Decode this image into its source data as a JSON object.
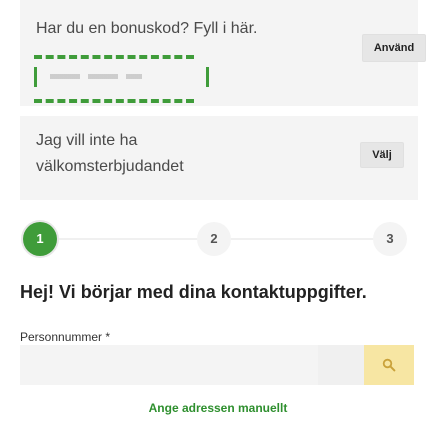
{
  "bonus": {
    "title": "Har du en bonuskod? Fyll i här.",
    "apply_label": "Använd"
  },
  "no_offer": {
    "text": "Jag vill inte ha välkomsterbjudandet",
    "choose_label": "Välj"
  },
  "steps": [
    {
      "label": "1",
      "active": true
    },
    {
      "label": "2",
      "active": false
    },
    {
      "label": "3",
      "active": false
    }
  ],
  "form": {
    "heading": "Hej! Vi börjar med dina kontaktuppgifter.",
    "personnummer_label": "Personnummer *",
    "personnummer_value": "",
    "search_icon": "search-icon",
    "manual_address_link": "Ange adressen manuellt"
  },
  "colors": {
    "accent_green": "#3f9c3a",
    "search_button_bg": "#f7e6a3",
    "panel_bg": "#f4f4f4"
  }
}
